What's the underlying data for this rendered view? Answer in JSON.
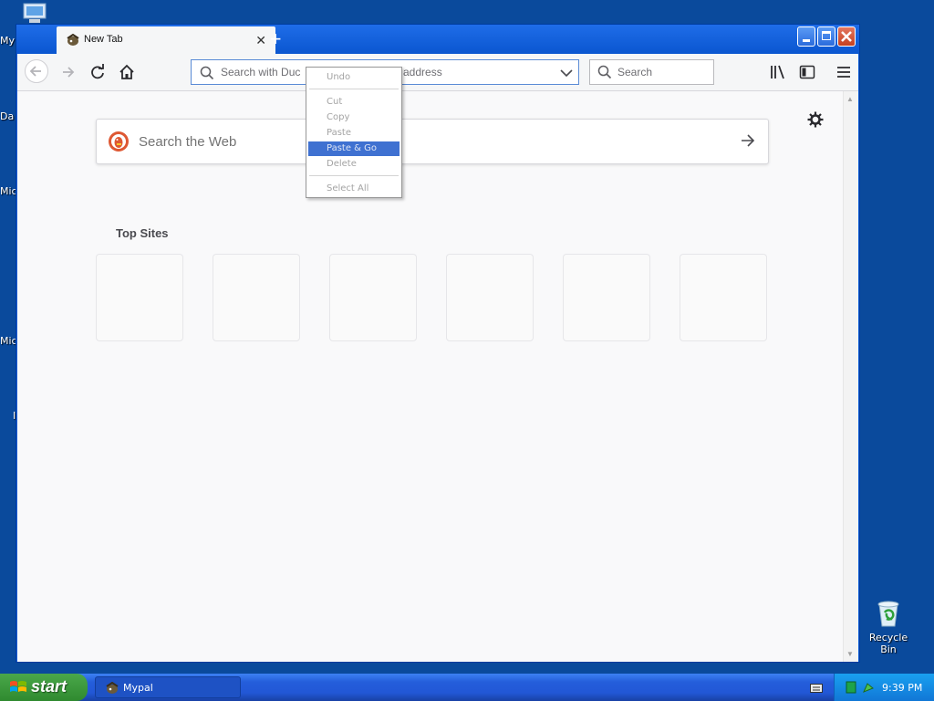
{
  "desktop": {
    "partial_labels": [
      "My",
      "Da",
      "Mic",
      "Mic",
      "I"
    ],
    "recycle_bin_label": "Recycle Bin"
  },
  "window": {
    "tab": {
      "title": "New Tab"
    },
    "url_placeholder": "Search with DuckDuckGo or enter address",
    "url_visible_left": "Search with Duc",
    "url_visible_right": "address",
    "search_placeholder": "Search"
  },
  "newtab": {
    "web_search_placeholder": "Search the Web",
    "top_sites_label": "Top Sites",
    "tile_count": 6
  },
  "context_menu": {
    "items": [
      "Undo",
      "Cut",
      "Copy",
      "Paste",
      "Paste & Go",
      "Delete",
      "Select All"
    ],
    "highlighted": "Paste & Go"
  },
  "taskbar": {
    "start_label": "start",
    "task_label": "Mypal",
    "clock": "9:39 PM"
  },
  "colors": {
    "desktop": "#0a4a9c",
    "menu_highlight": "#3f71d1",
    "urlbar_focus": "#5a8bd6"
  }
}
